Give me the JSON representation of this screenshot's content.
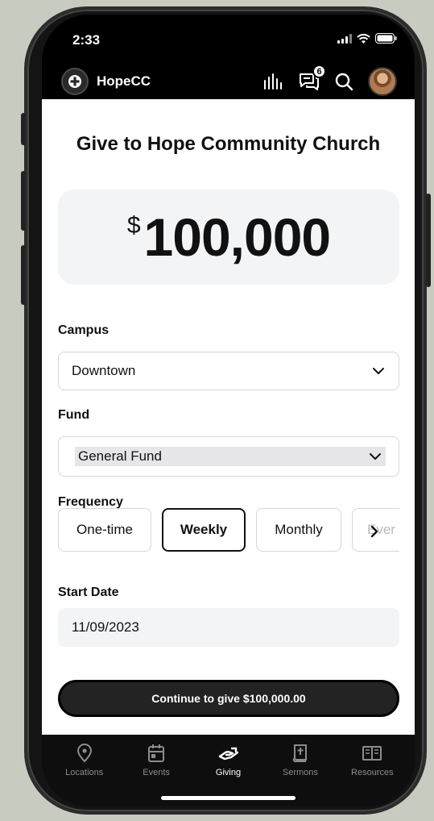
{
  "status_bar": {
    "time": "2:33"
  },
  "header": {
    "brand": "HopeCC",
    "messages_badge": "6"
  },
  "page": {
    "title": "Give to Hope Community Church"
  },
  "amount": {
    "currency": "$",
    "value": "100,000"
  },
  "campus": {
    "label": "Campus",
    "value": "Downtown"
  },
  "fund": {
    "label": "Fund",
    "value": "General Fund"
  },
  "frequency": {
    "label": "Frequency",
    "options": [
      "One-time",
      "Weekly",
      "Monthly",
      "Ever"
    ],
    "selected": "Weekly"
  },
  "start_date": {
    "label": "Start Date",
    "value": "11/09/2023"
  },
  "continue_button": {
    "label": "Continue to give $100,000.00"
  },
  "bottom_nav": {
    "items": [
      {
        "label": "Locations",
        "icon": "location-pin-icon"
      },
      {
        "label": "Events",
        "icon": "calendar-icon"
      },
      {
        "label": "Giving",
        "icon": "giving-hand-icon"
      },
      {
        "label": "Sermons",
        "icon": "bible-icon"
      },
      {
        "label": "Resources",
        "icon": "book-open-icon"
      }
    ],
    "active": "Giving"
  },
  "colors": {
    "header_bg": "#000000",
    "content_bg": "#ffffff",
    "primary_button": "#232323",
    "field_bg": "#f3f4f6",
    "nav_inactive": "#8c8c8c"
  }
}
